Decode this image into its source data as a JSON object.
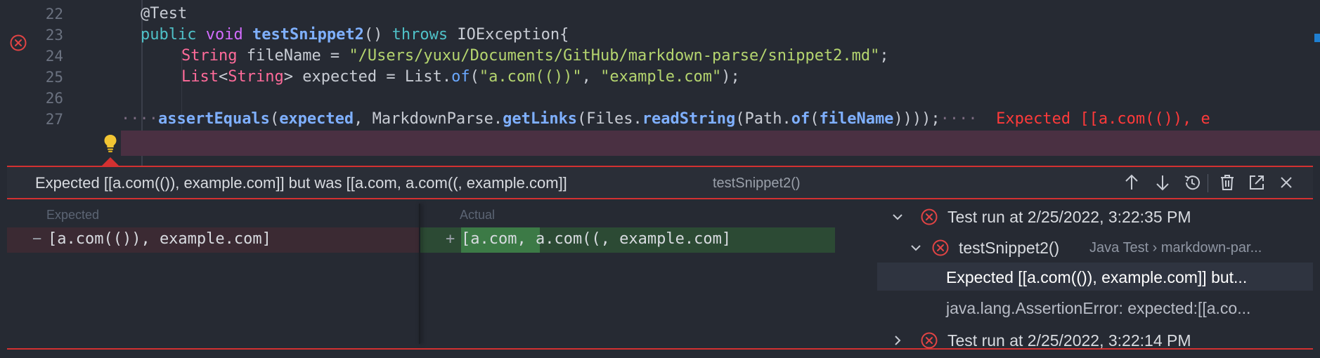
{
  "editor": {
    "lines": [
      {
        "num": "22",
        "text": "@Test"
      },
      {
        "num": "23",
        "kw1": "public",
        "kw2": "void",
        "fn": "testSnippet2",
        "paren": "()",
        "kw3": "throws",
        "exc": "IOException{"
      },
      {
        "num": "24",
        "type": "String",
        "rest1": " fileName = ",
        "str": "\"/Users/yuxu/Documents/GitHub/markdown-parse/snippet2.md\"",
        "end": ";"
      },
      {
        "num": "25",
        "type1": "List",
        "lt": "<",
        "type2": "String",
        "gt": ">",
        "rest1": " expected = List.",
        "kw": "of",
        "p1": "(",
        "s1": "\"a.com(())\"",
        "comma": ", ",
        "s2": "\"example.com\"",
        "end": ");"
      },
      {
        "num": "26"
      },
      {
        "num": "27",
        "dots1": "····",
        "fn": "assertEquals",
        "p1": "(",
        "arg1": "expected",
        "c1": ", ",
        "cls": "MarkdownParse",
        "dot1": ".",
        "fn2": "getLinks",
        "p2": "(Files.",
        "fn3": "readString",
        "p3": "(Path.",
        "kw": "of",
        "p4": "(",
        "arg2": "fileName",
        "end": "))));",
        "dots2": "····",
        "inline_err": "Expected [[a.com(()), e"
      }
    ]
  },
  "peek": {
    "message": "Expected [[a.com(()), example.com]] but was [[a.com, a.com((, example.com]]",
    "test_name": "testSnippet2()",
    "expected_label": "Expected",
    "actual_label": "Actual",
    "expected_marker": "−",
    "expected_text": "[a.com(()), example.com]",
    "actual_marker": "+",
    "actual_text": "[a.com, a.com((, example.com]"
  },
  "tree": [
    {
      "label": "Test run at 2/25/2022, 3:22:35 PM",
      "expanded": true
    },
    {
      "label": "testSnippet2()",
      "detail": "Java Test › markdown-par..."
    },
    {
      "label": "Expected [[a.com(()), example.com]] but..."
    },
    {
      "label": "java.lang.AssertionError: expected:[[a.co..."
    },
    {
      "label": "Test run at 2/25/2022, 3:22:14 PM",
      "expanded": false
    }
  ],
  "colors": {
    "error": "#d33131",
    "expected_bg": "#4b2f38",
    "actual_bg": "#2f5a36",
    "background": "#262a33"
  },
  "icons": [
    "error-circle-icon",
    "lightbulb-icon",
    "arrow-up-icon",
    "arrow-down-icon",
    "history-icon",
    "trash-icon",
    "open-external-icon",
    "close-icon",
    "chevron-down-icon",
    "chevron-right-icon"
  ]
}
